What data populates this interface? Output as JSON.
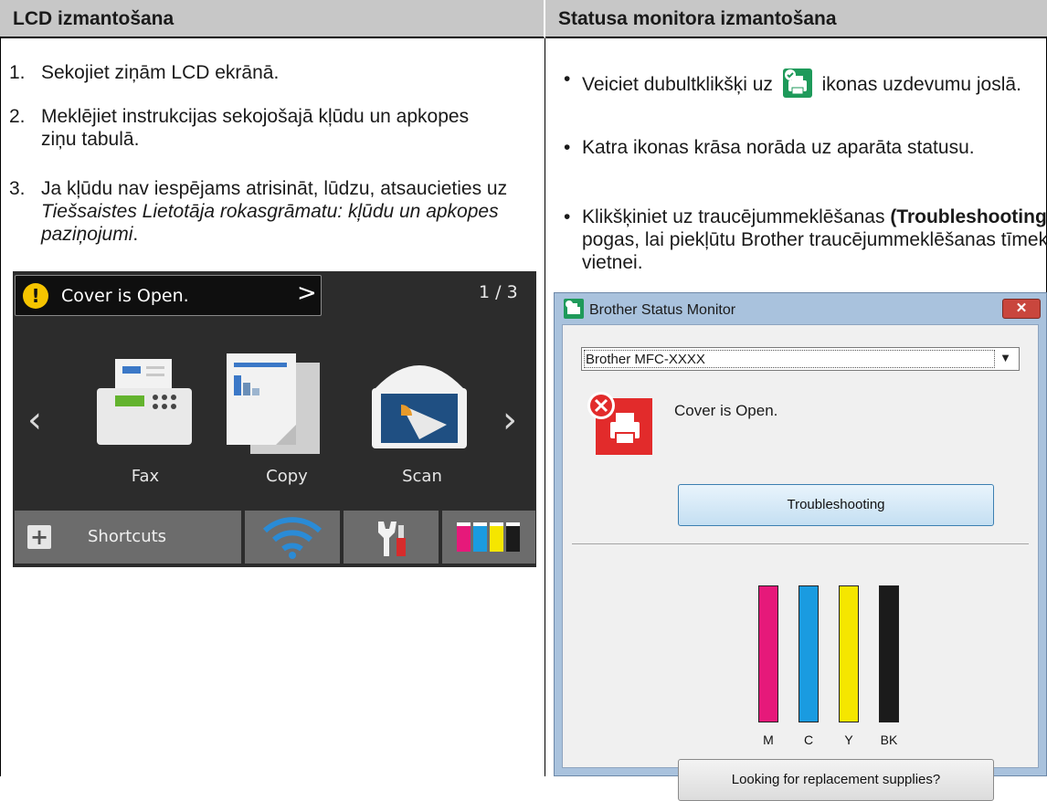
{
  "header": {
    "left": "LCD izmantošana",
    "right": "Statusa monitora izmantošana"
  },
  "left_steps": [
    {
      "num": "1.",
      "text": "Sekojiet ziņām LCD ekrānā."
    },
    {
      "num": "2.",
      "text": "Meklējiet instrukcijas sekojošajā kļūdu un apkopes ziņu tabulā."
    },
    {
      "num": "3.",
      "text_before": "Ja kļūdu nav iespējams atrisināt, lūdzu, atsaucieties uz ",
      "text_italic": "Tiešsaistes Lietotāja rokasgrāmatu: kļūdu un apkopes paziņojumi",
      "text_after": "."
    }
  ],
  "right_bullets": [
    {
      "before": "Veiciet dubultklikšķi uz ",
      "after": " ikonas uzdevumu joslā."
    },
    {
      "text": "Katra ikonas krāsa norāda uz aparāta statusu."
    },
    {
      "before": "Klikšķiniet uz traucējummeklēšanas ",
      "bold": "(Troubleshooting)",
      "after": " pogas, lai piekļūtu Brother traucējummeklēšanas tīmekļa vietnei."
    }
  ],
  "lcd": {
    "message": "Cover is Open.",
    "page": "1 / 3",
    "icons": [
      {
        "label": "Fax",
        "icon": "fax-icon"
      },
      {
        "label": "Copy",
        "icon": "copy-icon"
      },
      {
        "label": "Scan",
        "icon": "scan-icon"
      }
    ],
    "shortcuts_label": "Shortcuts",
    "colors": {
      "background": "#2c2c2c",
      "warning": "#f6c400",
      "button": "#6c6c6c",
      "wifi": "#2a8bd6"
    }
  },
  "status_monitor": {
    "title": "Brother Status Monitor",
    "printer": "Brother MFC-XXXX",
    "status_text": "Cover is Open.",
    "troubleshooting_button": "Troubleshooting",
    "inks": [
      {
        "label": "M",
        "color": "#e6197a"
      },
      {
        "label": "C",
        "color": "#1a9be0"
      },
      {
        "label": "Y",
        "color": "#f5e600"
      },
      {
        "label": "BK",
        "color": "#1b1b1b"
      }
    ],
    "supplies_button": "Looking for replacement supplies?",
    "colors": {
      "title_bar": "#a9c2dd",
      "close": "#c9463d",
      "error": "#e22b2b"
    }
  }
}
